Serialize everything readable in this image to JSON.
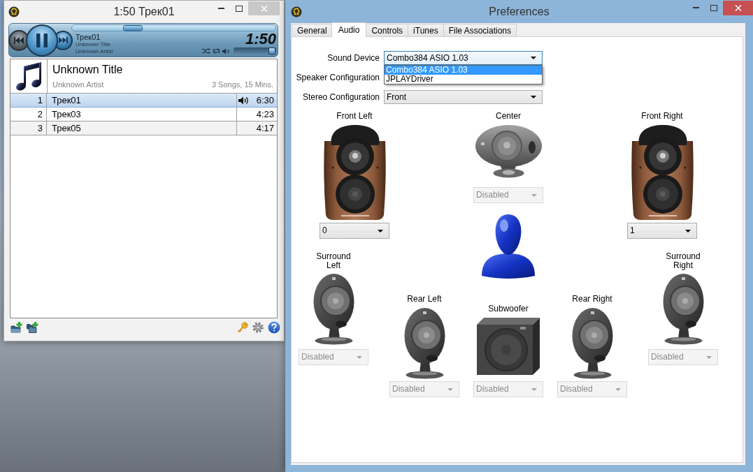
{
  "player_window": {
    "title": "1:50 Трек01",
    "playing": true,
    "seek": {
      "level": 0.28
    },
    "track": "Трек01",
    "song_title": "Unknown Title",
    "song_artist": "Unknown Artist",
    "elapsed": "1:50",
    "volume": {
      "level": 0.98
    },
    "playlist": {
      "album": "Unknown Title",
      "artist": "Unknown Artist",
      "summary": "3 Songs, 15 Mins.",
      "tracks": [
        {
          "number": "1",
          "title": "Трек01",
          "duration": "6:30",
          "selected": true,
          "playing": true
        },
        {
          "number": "2",
          "title": "Трек03",
          "duration": "4:23",
          "selected": false,
          "playing": false
        },
        {
          "number": "3",
          "title": "Трек05",
          "duration": "4:17",
          "selected": false,
          "playing": false
        }
      ]
    }
  },
  "preferences_window": {
    "title": "Preferences",
    "tabs": [
      {
        "label": "General",
        "selected": false
      },
      {
        "label": "Audio",
        "selected": true
      },
      {
        "label": "Controls",
        "selected": false
      },
      {
        "label": "iTunes",
        "selected": false
      },
      {
        "label": "File Associations",
        "selected": false
      }
    ],
    "sound_device": {
      "label": "Sound Device",
      "value": "Combo384 ASIO 1.03",
      "expanded": true,
      "options": [
        {
          "label": "Combo384 ASIO 1.03",
          "selected": true
        },
        {
          "label": "JPLAYDriver",
          "selected": false
        }
      ]
    },
    "speaker_configuration": {
      "label": "Speaker Configuration"
    },
    "stereo_configuration": {
      "label": "Stereo Configuration",
      "value": "Front"
    },
    "speakers": [
      {
        "kind": "bookshelf",
        "label": "Front Left",
        "value": "0",
        "disabled": false
      },
      {
        "kind": "center",
        "label": "Center",
        "value": "Disabled",
        "disabled": true
      },
      {
        "kind": "bookshelf",
        "label": "Front Right",
        "value": "1",
        "disabled": false
      },
      {
        "kind": "satellite",
        "label": "Surround Left",
        "value": "Disabled",
        "disabled": true
      },
      {
        "kind": "satellite",
        "label": "Rear Left",
        "value": "Disabled",
        "disabled": true
      },
      {
        "kind": "subwoofer",
        "label": "Subwoofer",
        "value": "Disabled",
        "disabled": true
      },
      {
        "kind": "satellite",
        "label": "Rear Right",
        "value": "Disabled",
        "disabled": true
      },
      {
        "kind": "satellite",
        "label": "Surround Right",
        "value": "Disabled",
        "disabled": true
      }
    ]
  }
}
